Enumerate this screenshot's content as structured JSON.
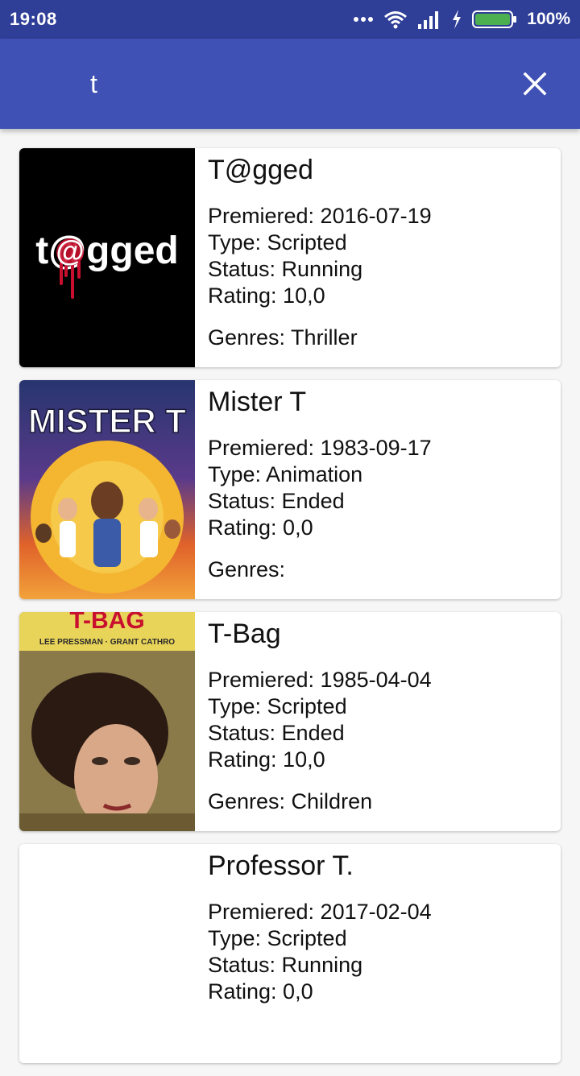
{
  "status_bar": {
    "time": "19:08",
    "battery_percent": "100%",
    "icons": [
      "more-dots-icon",
      "wifi-icon",
      "signal-icon",
      "charging-bolt-icon",
      "battery-icon"
    ]
  },
  "search": {
    "value": "t"
  },
  "colors": {
    "status_bar": "#2f3e97",
    "toolbar": "#3f51b5",
    "battery_fill": "#4caf50"
  },
  "results": [
    {
      "title": "T@gged",
      "premiered": "Premiered: 2016-07-19",
      "type": "Type: Scripted",
      "status": "Status: Running",
      "rating": "Rating: 10,0",
      "genres": "Genres: Thriller",
      "poster_text": "t@gged"
    },
    {
      "title": "Mister T",
      "premiered": "Premiered: 1983-09-17",
      "type": "Type: Animation",
      "status": "Status: Ended",
      "rating": "Rating: 0,0",
      "genres": "Genres:",
      "poster_text": "MISTER T"
    },
    {
      "title": "T-Bag",
      "premiered": "Premiered: 1985-04-04",
      "type": "Type: Scripted",
      "status": "Status: Ended",
      "rating": "Rating: 10,0",
      "genres": "Genres: Children",
      "poster_text": "T-BAG",
      "poster_subtext": "LEE PRESSMAN · GRANT CATHRO"
    },
    {
      "title": "Professor T.",
      "premiered": "Premiered: 2017-02-04",
      "type": "Type: Scripted",
      "status": "Status: Running",
      "rating": "Rating: 0,0",
      "genres": ""
    }
  ]
}
